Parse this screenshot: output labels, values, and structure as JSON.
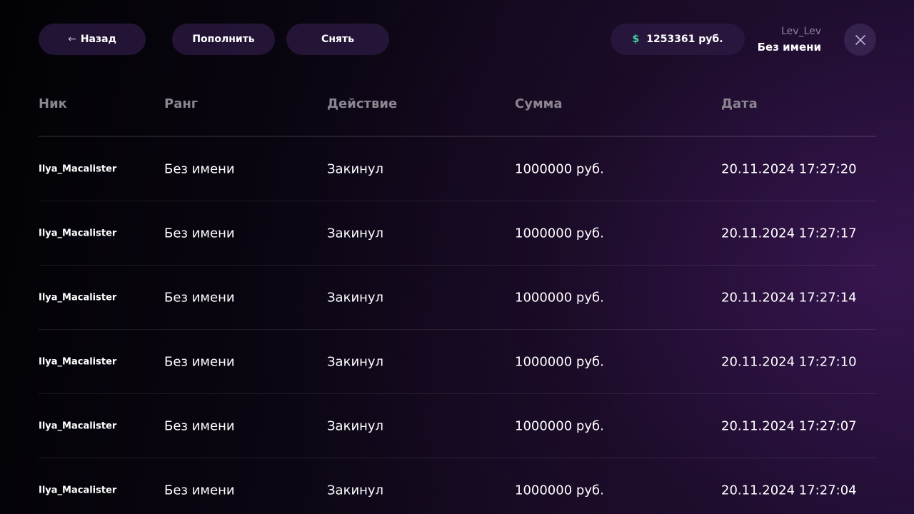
{
  "toolbar": {
    "back_label": "Назад",
    "back_icon": "arrow-left-icon",
    "deposit_label": "Пополнить",
    "withdraw_label": "Снять",
    "balance_icon": "$",
    "balance_value": "1253361 руб.",
    "close_icon": "close-icon"
  },
  "user": {
    "login": "Lev_Lev",
    "rank": "Без имени"
  },
  "table": {
    "headers": [
      "Ник",
      "Ранг",
      "Действие",
      "Сумма",
      "Дата"
    ],
    "rows": [
      [
        "Ilya_Macalister",
        "Без имени",
        "Закинул",
        "1000000 руб.",
        "20.11.2024 17:27:20"
      ],
      [
        "Ilya_Macalister",
        "Без имени",
        "Закинул",
        "1000000 руб.",
        "20.11.2024 17:27:17"
      ],
      [
        "Ilya_Macalister",
        "Без имени",
        "Закинул",
        "1000000 руб.",
        "20.11.2024 17:27:14"
      ],
      [
        "Ilya_Macalister",
        "Без имени",
        "Закинул",
        "1000000 руб.",
        "20.11.2024 17:27:10"
      ],
      [
        "Ilya_Macalister",
        "Без имени",
        "Закинул",
        "1000000 руб.",
        "20.11.2024 17:27:07"
      ],
      [
        "Ilya_Macalister",
        "Без имени",
        "Закинул",
        "1000000 руб.",
        "20.11.2024 17:27:04"
      ]
    ]
  },
  "colors": {
    "accent_currency": "#3fd6a0",
    "pill_bg": "#2c1a42",
    "header_text": "#8b8590"
  }
}
